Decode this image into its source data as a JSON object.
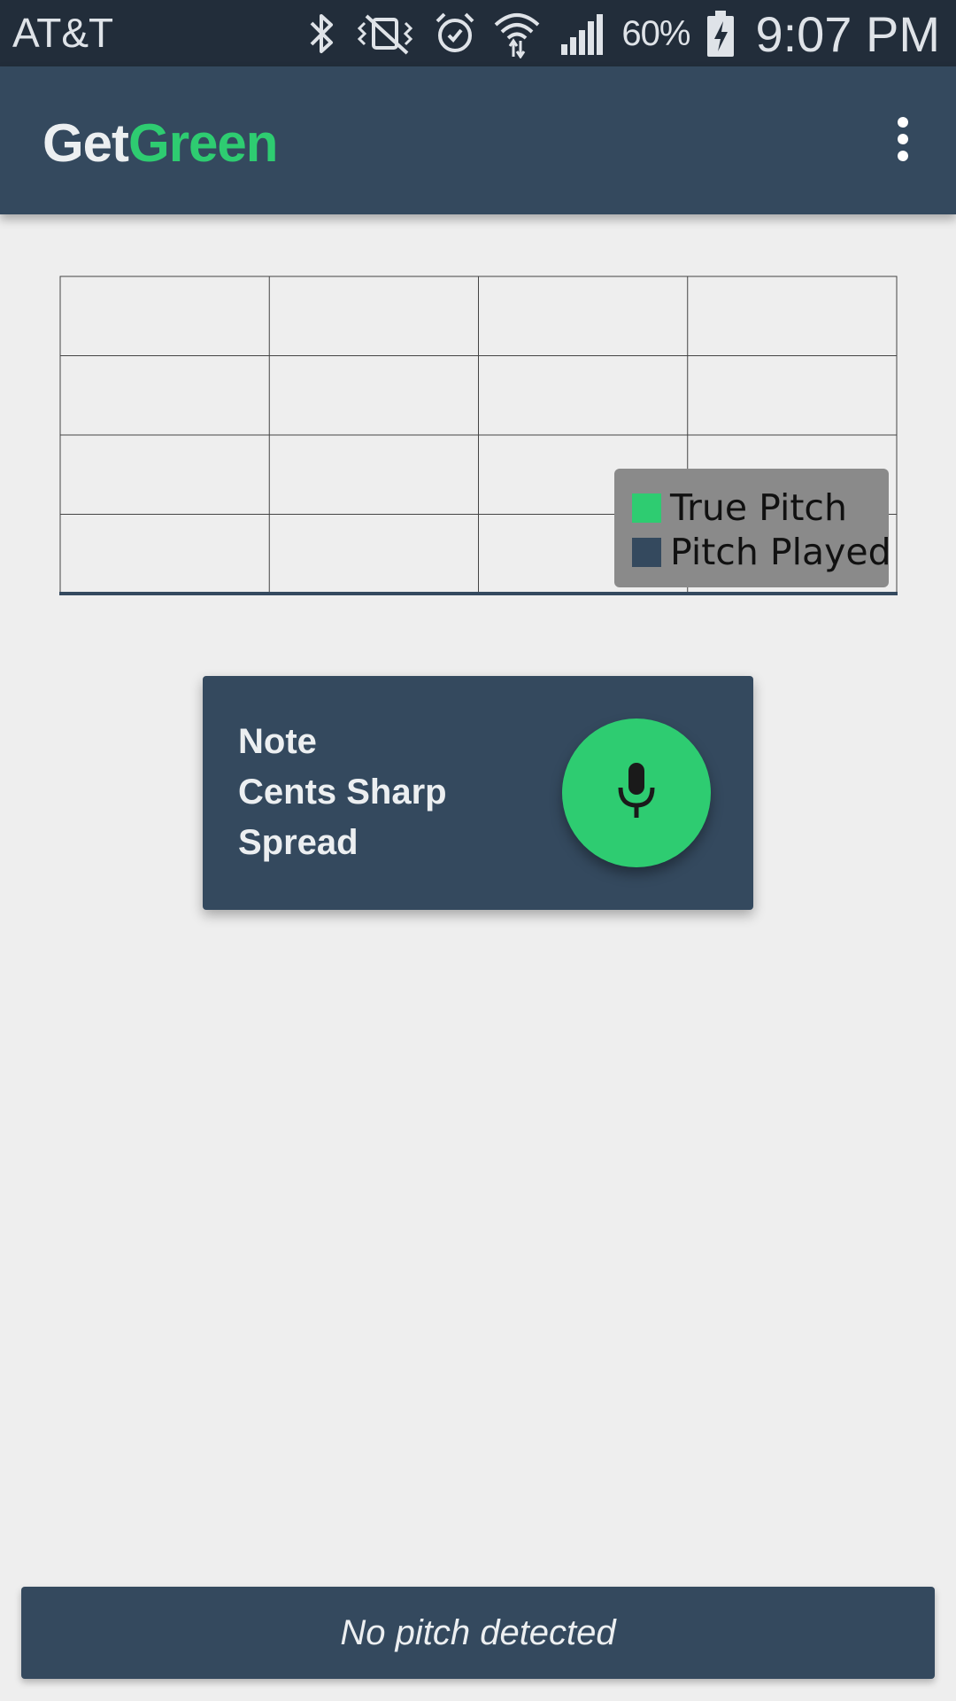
{
  "status_bar": {
    "carrier": "AT&T",
    "battery_percent": "60%",
    "time": "9:07 PM",
    "icons": [
      "bluetooth-icon",
      "vibrate-mute-icon",
      "alarm-icon",
      "wifi-icon",
      "cell-signal-icon",
      "battery-charging-icon"
    ]
  },
  "app_bar": {
    "title_part1": "Get",
    "title_part2": "Green",
    "menu_icon": "overflow-menu-icon"
  },
  "chart_data": {
    "type": "line",
    "grid": true,
    "grid_columns": 4,
    "grid_rows": 4,
    "legend_position": "bottom-right",
    "series": [
      {
        "name": "True Pitch",
        "color": "#2ecc71",
        "values": []
      },
      {
        "name": "Pitch Played",
        "color": "#34495e",
        "values": []
      }
    ]
  },
  "info_card": {
    "note_label": "Note",
    "cents_label": "Cents Sharp",
    "spread_label": "Spread",
    "mic_icon": "microphone-icon"
  },
  "pitch_status": {
    "text": "No pitch detected"
  },
  "colors": {
    "primary": "#34495e",
    "accent": "#2ecc71",
    "background": "#eeeeee",
    "status_bar": "#222d3a"
  }
}
